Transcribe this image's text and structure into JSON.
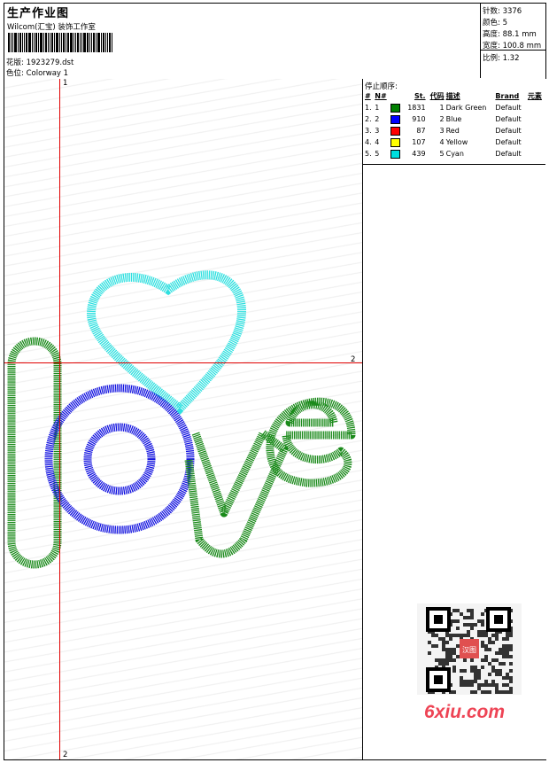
{
  "header": {
    "title": "生产作业图",
    "studio": "Wilcom(汇宝) 装饰工作室",
    "design_label": "花版:",
    "design_file": "1923279.dst",
    "colorway_label": "色位:",
    "colorway": "Colorway 1"
  },
  "stats": {
    "stitches": "针数: 3376",
    "colors": "颜色: 5",
    "height": "高度: 88.1 mm",
    "width": "宽度: 100.8 mm",
    "scale": "比例: 1.32"
  },
  "stop_sequence": {
    "title": "停止顺序:",
    "columns": [
      "#",
      "N#",
      "St.",
      "代码",
      "描述",
      "Brand",
      "元素"
    ],
    "rows": [
      {
        "idx": "1.",
        "n": "1",
        "st": "1831",
        "code": "1",
        "desc": "Dark Green",
        "brand": "Default",
        "color": "#008000"
      },
      {
        "idx": "2.",
        "n": "2",
        "st": "910",
        "code": "2",
        "desc": "Blue",
        "brand": "Default",
        "color": "#0000ff"
      },
      {
        "idx": "3.",
        "n": "3",
        "st": "87",
        "code": "3",
        "desc": "Red",
        "brand": "Default",
        "color": "#ff0000"
      },
      {
        "idx": "4.",
        "n": "4",
        "st": "107",
        "code": "4",
        "desc": "Yellow",
        "brand": "Default",
        "color": "#ffff00"
      },
      {
        "idx": "5.",
        "n": "5",
        "st": "439",
        "code": "5",
        "desc": "Cyan",
        "brand": "Default",
        "color": "#00e0e0"
      }
    ]
  },
  "guides": {
    "v_top": "1",
    "h_right": "2",
    "v_bottom": "2"
  },
  "qr": {
    "stamp": "汉图"
  },
  "watermark": "6xiu.com",
  "colors": {
    "green": "#1a8a1a",
    "blue": "#1414e0",
    "cyan": "#30e0e0",
    "guide_red": "#e00000"
  }
}
